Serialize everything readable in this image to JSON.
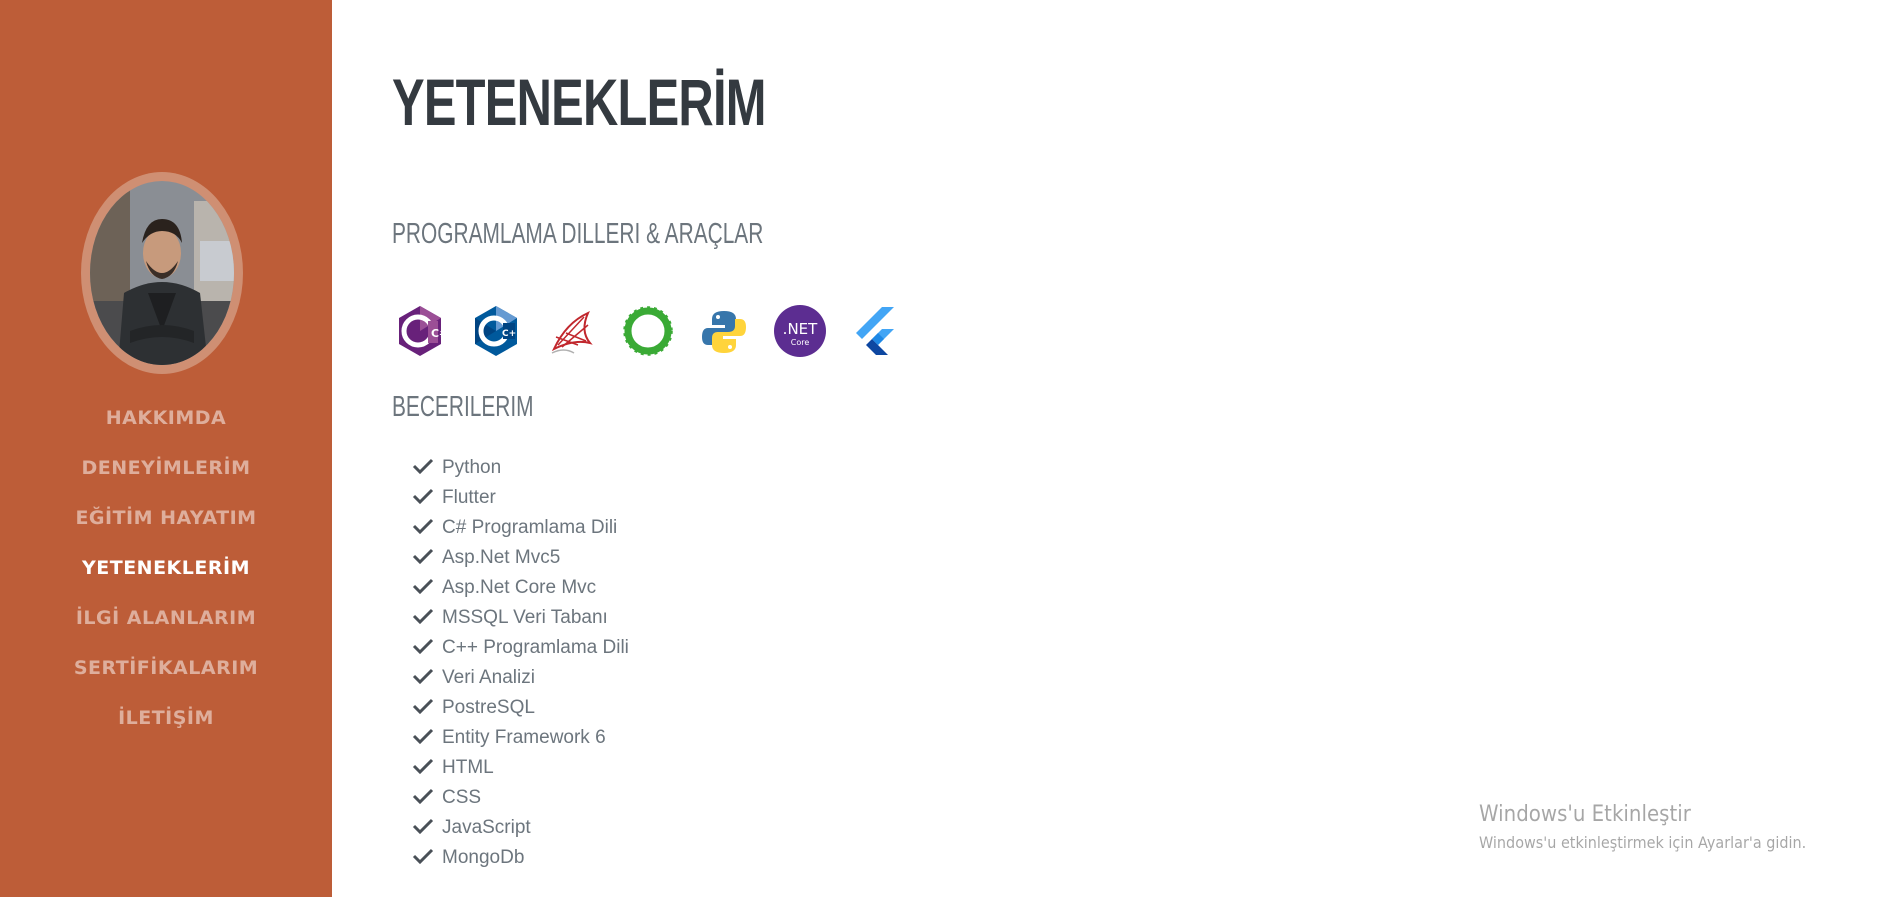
{
  "nav": {
    "items": [
      {
        "label": "HAKKIMDA",
        "active": false
      },
      {
        "label": "DENEYİMLERİM",
        "active": false
      },
      {
        "label": "EĞİTİM HAYATIM",
        "active": false
      },
      {
        "label": "YETENEKLERİM",
        "active": true
      },
      {
        "label": "İLGİ ALANLARIM",
        "active": false
      },
      {
        "label": "SERTİFİKALARIM",
        "active": false
      },
      {
        "label": "İLETİŞİM",
        "active": false
      }
    ]
  },
  "main": {
    "title": "YETENEKLERİM",
    "tools_heading": "PROGRAMLAMA DILLERI & ARAÇLAR",
    "tools": [
      {
        "icon": "csharp-icon",
        "label": "C#"
      },
      {
        "icon": "cpp-icon",
        "label": "C++"
      },
      {
        "icon": "sql-server-icon",
        "label": ""
      },
      {
        "icon": "dotnet-ring-icon",
        "label": ""
      },
      {
        "icon": "python-icon",
        "label": ""
      },
      {
        "icon": "dotnet-core-icon",
        "label": ".NET",
        "sublabel": "Core"
      },
      {
        "icon": "flutter-icon",
        "label": ""
      }
    ],
    "skills_heading": "BECERILERIM",
    "skills": [
      "Python",
      "Flutter",
      "C# Programlama Dili",
      "Asp.Net Mvc5",
      "Asp.Net Core Mvc",
      "MSSQL Veri Tabanı",
      "C++ Programlama Dili",
      "Veri Analizi",
      "PostreSQL",
      "Entity Framework 6",
      "HTML",
      "CSS",
      "JavaScript",
      "MongoDb"
    ]
  },
  "watermark": {
    "title": "Windows'u Etkinleştir",
    "subtitle": "Windows'u etkinleştirmek için Ayarlar'a gidin."
  },
  "colors": {
    "sidebar": "#bd5d38",
    "title": "#343a40",
    "muted": "#6c757d"
  }
}
